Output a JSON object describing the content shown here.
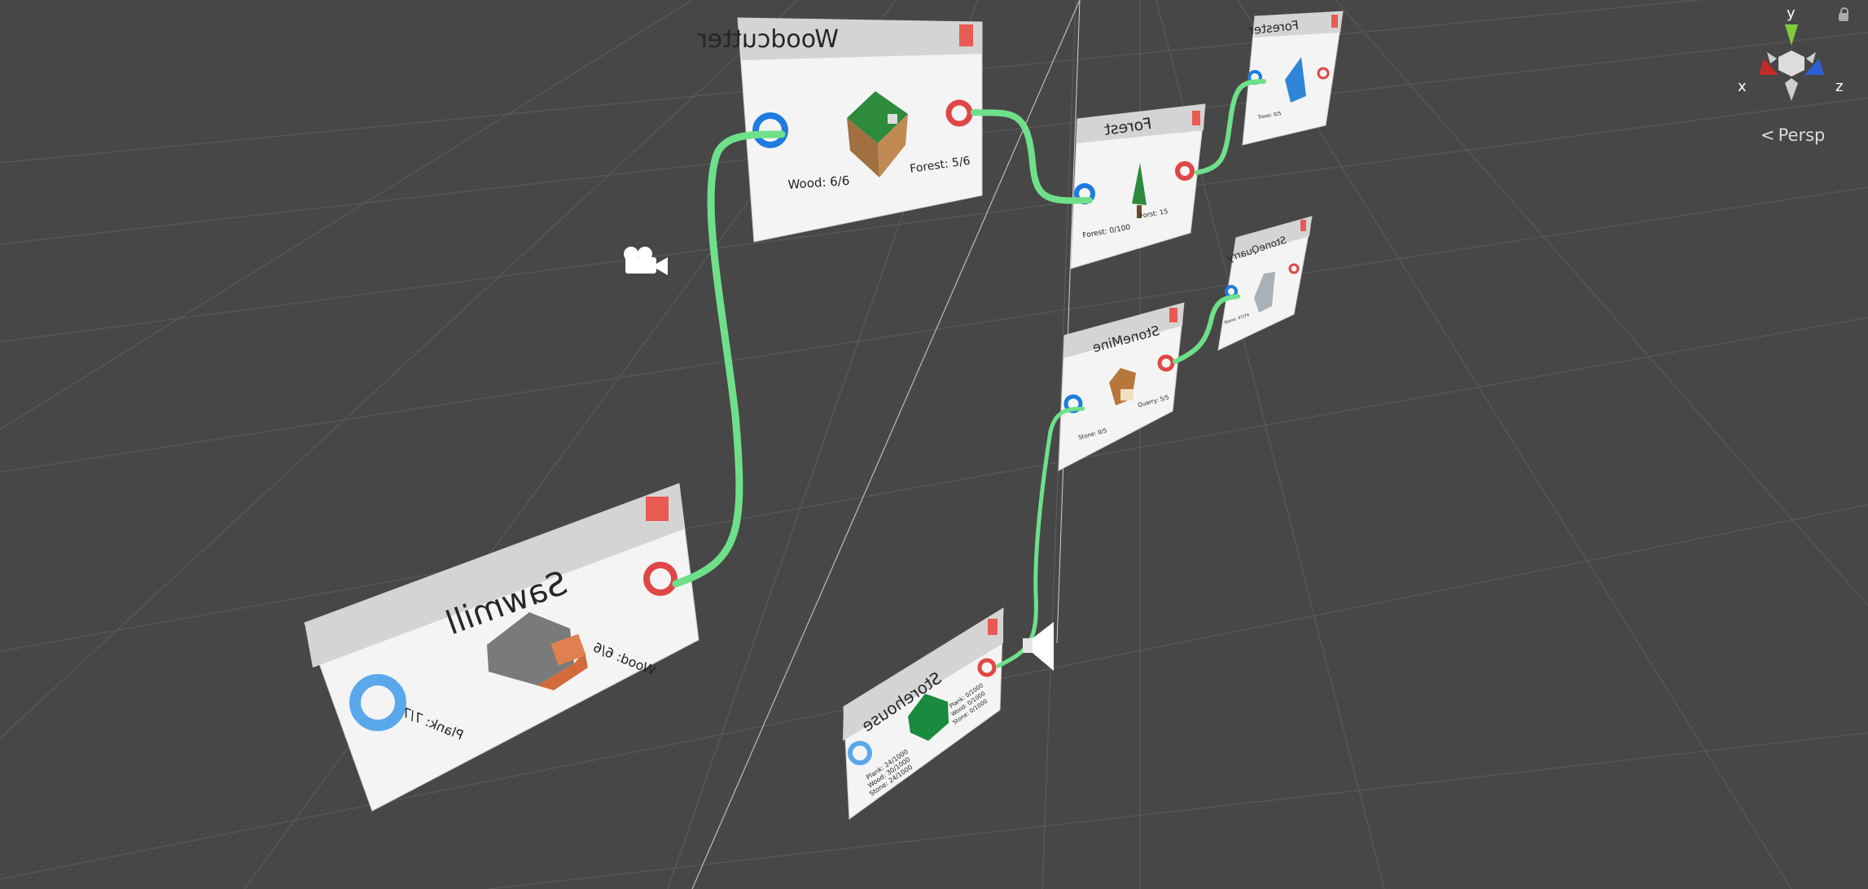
{
  "scene": {
    "view_mode": "Persp",
    "gizmo_axes": {
      "x": "x",
      "y": "y",
      "z": "z"
    },
    "colors": {
      "background": "#474747",
      "connection": "#6fe08a",
      "input_port": "#1e7be0",
      "output_port": "#e04646",
      "card": "#f4f4f4",
      "header": "#d4d4d4",
      "close": "#e85a52"
    }
  },
  "nodes": {
    "woodcutter": {
      "title": "Woodcutter",
      "line1": "Wood: 6/6",
      "line2": "Forest: 5/6"
    },
    "forest_mid": {
      "title": "Forest",
      "line1": "Forest: 0/100",
      "line2": "Forst: 15"
    },
    "forester": {
      "title": "Forester",
      "line1": "Trees: 0/5"
    },
    "stonemine": {
      "title": "StoneMine",
      "line1": "Stone: 0/5",
      "line2": "Quarry: 5/5"
    },
    "stonequarry": {
      "title": "StoneQuarry",
      "line1": "Stone: 47/74"
    },
    "sawmill": {
      "title": "Sawmill",
      "line1": "Wood: 6/6",
      "line2": "Plank: 7/7"
    },
    "storehouse": {
      "title": "Storehouse",
      "in_lines": [
        "Plank: 0/1000",
        "Wood: 0/1000",
        "Stone: 0/1000"
      ],
      "out_lines": [
        "Plank: 24/1000",
        "Wood: 30/1000",
        "Stone: 24/1000"
      ]
    }
  }
}
